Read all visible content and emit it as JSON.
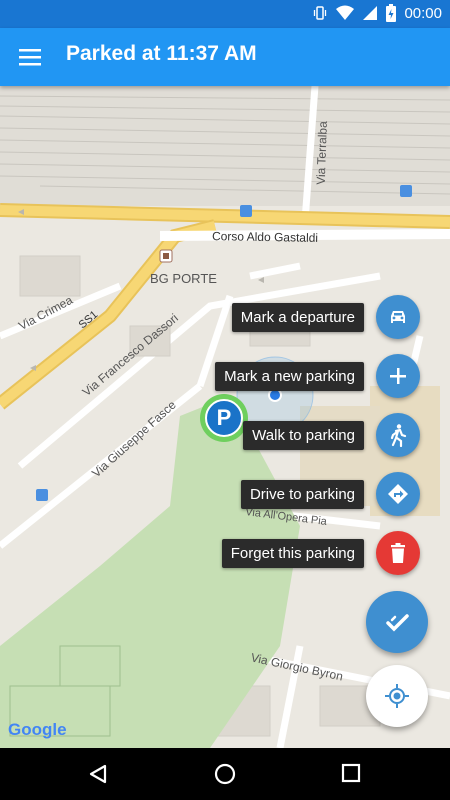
{
  "status_bar": {
    "time": "00:00",
    "icons": [
      "vibrate-icon",
      "wifi-icon",
      "signal-icon",
      "battery-icon"
    ]
  },
  "app_bar": {
    "title": "Parked at 11:37 AM",
    "menu_icon": "menu-icon"
  },
  "map": {
    "street_labels": {
      "corso": "Corso Aldo Gastaldi",
      "terralba": "Via Terralba",
      "bg_porte": "BG PORTE",
      "crimea": "Via Crimea",
      "ss1": "SS1",
      "dassori": "Via Francesco Dassori",
      "fasce": "Via Giuseppe Fasce",
      "opera_pia": "Via All'Opera Pia",
      "byron": "Via Giorgio Byron"
    },
    "parking_marker": "P",
    "google_logo": "Google"
  },
  "actions": [
    {
      "label": "Mark a departure",
      "icon": "car-icon",
      "color": "#3f8fd0"
    },
    {
      "label": "Mark a new parking",
      "icon": "plus-icon",
      "color": "#3f8fd0"
    },
    {
      "label": "Walk to parking",
      "icon": "walk-icon",
      "color": "#3f8fd0"
    },
    {
      "label": "Drive to parking",
      "icon": "directions-icon",
      "color": "#3f8fd0"
    },
    {
      "label": "Forget this parking",
      "icon": "trash-icon",
      "color": "#e53935"
    }
  ],
  "main_fab": {
    "icon": "check-icon",
    "color": "#3f8fd0"
  },
  "location_fab": {
    "icon": "my-location-icon",
    "color": "#ffffff"
  },
  "nav": {
    "back": "back-icon",
    "home": "home-icon",
    "recents": "recents-icon"
  },
  "colors": {
    "primary": "#2196f3",
    "status": "#1976d2",
    "accent": "#3f8fd0",
    "danger": "#e53935"
  }
}
